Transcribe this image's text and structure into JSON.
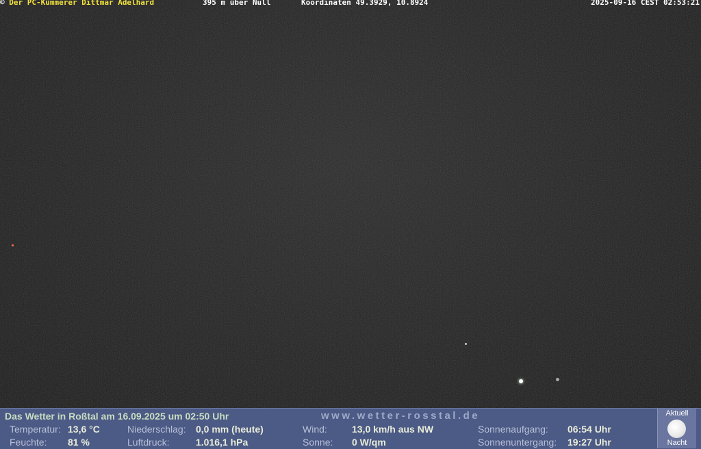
{
  "overlay": {
    "copyright_symbol": "©",
    "owner": "Der PC-Kümmerer Dittmar Adelhard",
    "altitude": "395 m über Null",
    "coordinates": "Koordinaten 49.3929, 10.8924",
    "timestamp": "2025-09-16 CEST 02:53:21"
  },
  "weather": {
    "title": "Das Wetter in Roßtal am 16.09.2025 um 02:50 Uhr",
    "url": "www.wetter-rosstal.de",
    "temperature": {
      "label": "Temperatur:",
      "value": "13,6 °C"
    },
    "humidity": {
      "label": "Feuchte:",
      "value": "81 %"
    },
    "precipitation": {
      "label": "Niederschlag:",
      "value": "0,0 mm (heute)"
    },
    "pressure": {
      "label": "Luftdruck:",
      "value": "1.016,1 hPa"
    },
    "wind": {
      "label": "Wind:",
      "value": "13,0 km/h aus NW"
    },
    "sun": {
      "label": "Sonne:",
      "value": "0 W/qm"
    },
    "sunrise": {
      "label": "Sonnenaufgang:",
      "value": "06:54 Uhr"
    },
    "sunset": {
      "label": "Sonnenuntergang:",
      "value": "19:27 Uhr"
    }
  },
  "moon": {
    "top_label": "Aktuell",
    "bottom_label": "Nacht",
    "icon": "full-moon-icon"
  },
  "colors": {
    "bar_background": "#4c5a86",
    "owner_text": "#f2e23c"
  }
}
